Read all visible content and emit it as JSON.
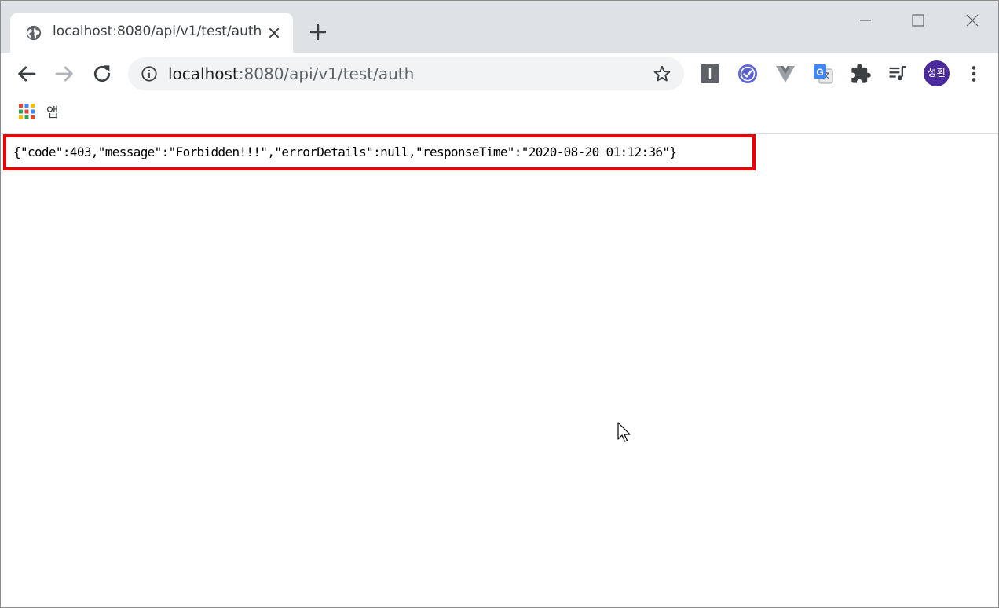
{
  "tab": {
    "title": "localhost:8080/api/v1/test/auth",
    "favicon": "globe-icon"
  },
  "omnibox": {
    "host": "localhost",
    "path": ":8080/api/v1/test/auth"
  },
  "extensions": [
    "instapaper-icon",
    "checkmark-extension-icon",
    "vue-devtools-icon",
    "google-translate-icon",
    "puzzle-extensions-icon",
    "media-playlist-icon"
  ],
  "profile": {
    "initials": "성환",
    "color": "#4a2a9c"
  },
  "bookmarks": {
    "apps_label": "앱"
  },
  "page": {
    "json_text": "{\"code\":403,\"message\":\"Forbidden!!!\",\"errorDetails\":null,\"responseTime\":\"2020-08-20 01:12:36\"}",
    "highlight_color": "#ee0000"
  }
}
